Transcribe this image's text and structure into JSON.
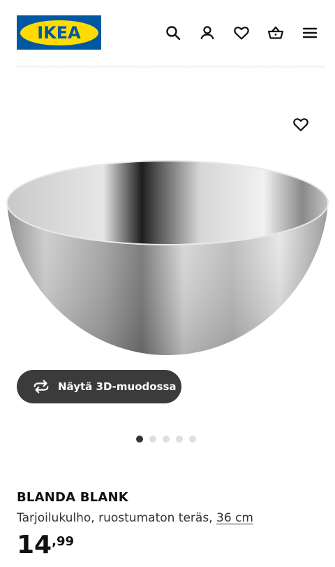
{
  "header": {
    "logo_text": "IKEA",
    "icons": [
      "search-icon",
      "user-icon",
      "heart-icon",
      "basket-icon",
      "menu-icon"
    ]
  },
  "gallery": {
    "view_3d_label": "Näytä 3D-muodossa",
    "image_count": 5,
    "active_index": 0
  },
  "product": {
    "name": "BLANDA BLANK",
    "description": "Tarjoilukulho, ruostumaton teräs, ",
    "size_link": "36 cm",
    "price_integer": "14",
    "price_decimal": ",99"
  },
  "colors": {
    "ikea_blue": "#0058a3",
    "ikea_yellow": "#ffdb00",
    "button_dark": "#3b3b3b"
  }
}
